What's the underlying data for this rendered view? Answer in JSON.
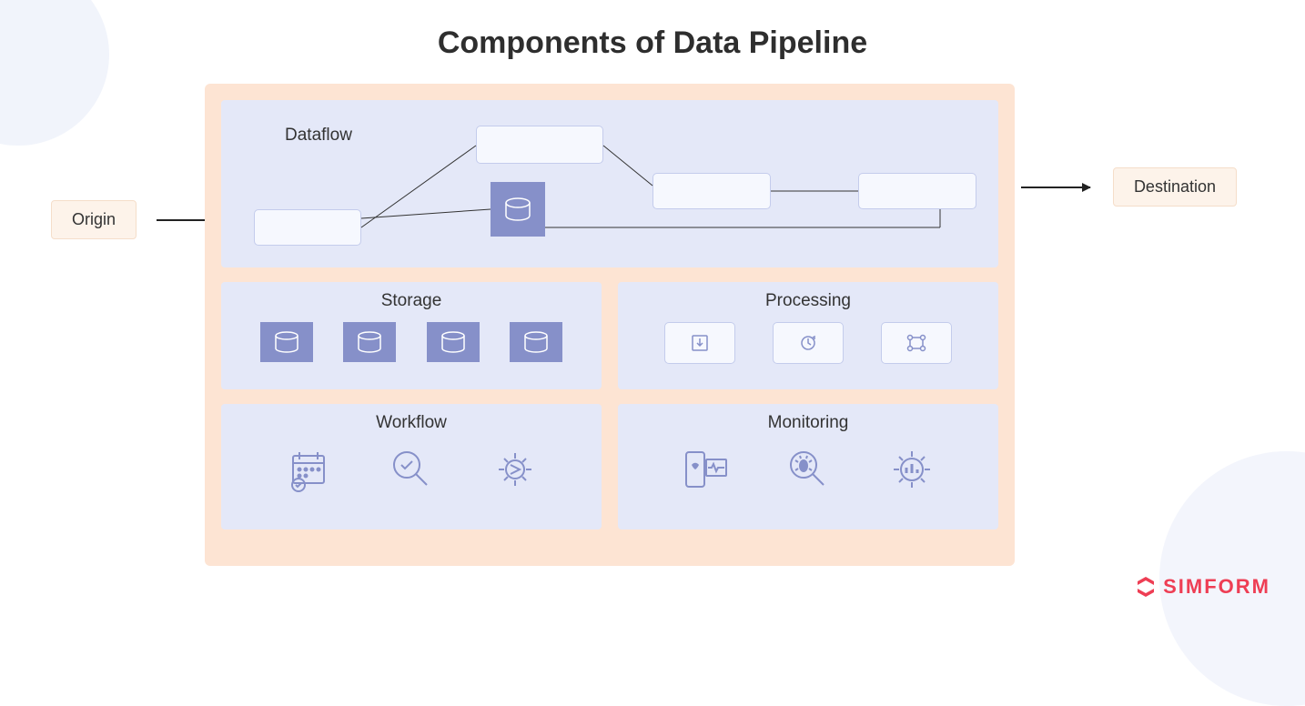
{
  "title": "Components of Data Pipeline",
  "origin_label": "Origin",
  "destination_label": "Destination",
  "sections": {
    "dataflow": "Dataflow",
    "storage": "Storage",
    "processing": "Processing",
    "workflow": "Workflow",
    "monitoring": "Monitoring"
  },
  "icons": {
    "storage": [
      "database-icon",
      "database-icon",
      "database-icon",
      "database-icon"
    ],
    "processing": [
      "download-icon",
      "refresh-icon",
      "graph-nodes-icon"
    ],
    "workflow": [
      "calendar-schedule-icon",
      "magnify-check-icon",
      "gear-arrows-icon"
    ],
    "monitoring": [
      "health-monitor-icon",
      "bug-magnify-icon",
      "gear-chart-icon"
    ]
  },
  "brand": "SIMFORM",
  "colors": {
    "peach": "#fde4d3",
    "lavender": "#e4e8f8",
    "purple": "#8690c9",
    "brand": "#ee3e54"
  }
}
